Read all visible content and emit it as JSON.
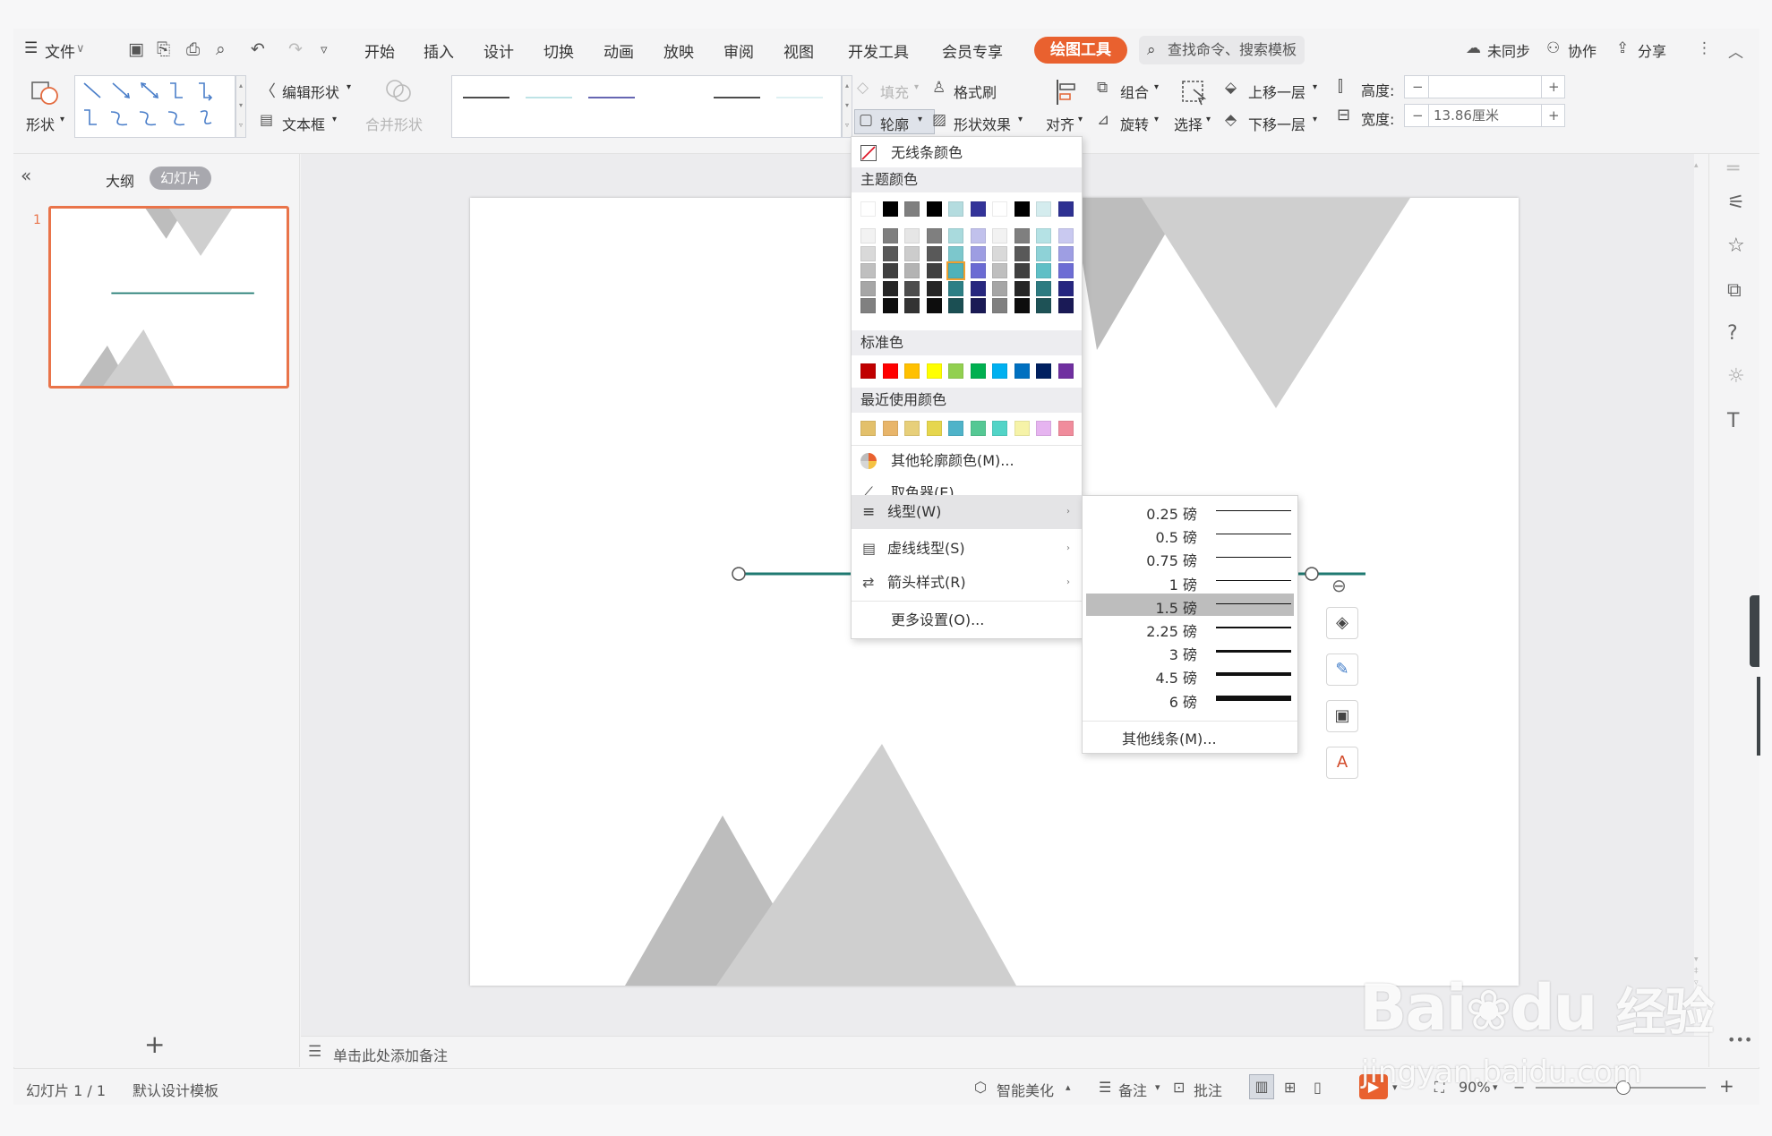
{
  "menubar": {
    "file_label": "文件",
    "tabs": [
      "开始",
      "插入",
      "设计",
      "切换",
      "动画",
      "放映",
      "审阅",
      "视图",
      "开发工具",
      "会员专享"
    ],
    "active_tab": "绘图工具",
    "search_placeholder": "查找命令、搜索模板",
    "sync_label": "未同步",
    "collab_label": "协作",
    "share_label": "分享"
  },
  "ribbon": {
    "shape_label": "形状",
    "edit_shape": "编辑形状",
    "textbox": "文本框",
    "merge_shape": "合并形状",
    "fill": "填充",
    "format_painter": "格式刷",
    "outline": "轮廓",
    "shape_effect": "形状效果",
    "align": "对齐",
    "group": "组合",
    "rotate": "旋转",
    "select": "选择",
    "bring_forward": "上移一层",
    "send_backward": "下移一层",
    "height_label": "高度:",
    "height_value": "",
    "width_label": "宽度:",
    "width_value": "13.86厘米"
  },
  "left_panel": {
    "outline_tab": "大纲",
    "slides_tab": "幻灯片",
    "slide_number": "1",
    "add_slide": "+"
  },
  "notes_placeholder": "单击此处添加备注",
  "outline_menu": {
    "no_line_color": "无线条颜色",
    "theme_colors_title": "主题颜色",
    "standard_colors_title": "标准色",
    "recent_colors_title": "最近使用颜色",
    "more_colors": "其他轮廓颜色(M)...",
    "eyedropper": "取色器(E)",
    "line_type": "线型(W)",
    "dash_type": "虚线线型(S)",
    "arrow_style": "箭头样式(R)",
    "more_settings": "更多设置(O)...",
    "theme_top_row": [
      "#ffffff",
      "#000000",
      "#7f7f7f",
      "#000000",
      "#b4dcdf",
      "#333399",
      "#ffffff",
      "#000000",
      "#d4ecee",
      "#2e3192"
    ],
    "theme_columns": [
      [
        "#f2f2f2",
        "#d9d9d9",
        "#bfbfbf",
        "#a6a6a6",
        "#808080"
      ],
      [
        "#7f7f7f",
        "#595959",
        "#404040",
        "#262626",
        "#0d0d0d"
      ],
      [
        "#e6e6e6",
        "#cccccc",
        "#b3b3b3",
        "#4d4d4d",
        "#333333"
      ],
      [
        "#7f7f7f",
        "#595959",
        "#404040",
        "#262626",
        "#0d0d0d"
      ],
      [
        "#a9dadd",
        "#7cc7cc",
        "#4fb2b9",
        "#2c7f85",
        "#1b4f53"
      ],
      [
        "#c1c1ec",
        "#9d9de2",
        "#6b6bd3",
        "#27277f",
        "#1a1a55"
      ],
      [
        "#f2f2f2",
        "#d9d9d9",
        "#bfbfbf",
        "#a6a6a6",
        "#808080"
      ],
      [
        "#7f7f7f",
        "#595959",
        "#404040",
        "#262626",
        "#0d0d0d"
      ],
      [
        "#b5e2e5",
        "#8ed2d7",
        "#5fbfc6",
        "#2d7b81",
        "#1e5256"
      ],
      [
        "#c9c9f0",
        "#9e9ee3",
        "#6d6dd4",
        "#262680",
        "#1a1a56"
      ]
    ],
    "standard_colors": [
      "#c00000",
      "#ff0000",
      "#ffc000",
      "#ffff00",
      "#92d050",
      "#00b050",
      "#00b0f0",
      "#0070c0",
      "#002060",
      "#7030a0"
    ],
    "recent_colors": [
      "#e3c06b",
      "#e8b56a",
      "#e7cf7a",
      "#e6d64e",
      "#4fb3c9",
      "#55c894",
      "#52d4c7",
      "#f6f3a8",
      "#e6b4f0",
      "#f08c9c"
    ]
  },
  "line_weight_menu": {
    "options": [
      "0.25 磅",
      "0.5 磅",
      "0.75 磅",
      "1 磅",
      "1.5 磅",
      "2.25 磅",
      "3 磅",
      "4.5 磅",
      "6 磅"
    ],
    "selected": "1.5 磅",
    "more_lines": "其他线条(M)..."
  },
  "statusbar": {
    "slide_counter": "幻灯片 1 / 1",
    "template": "默认设计模板",
    "beautify": "智能美化",
    "notes": "备注",
    "comments": "批注",
    "zoom": "90%"
  },
  "watermark": {
    "brand": "Bai",
    "brand2": "du",
    "brand_cn": "经验",
    "url": "jingyan.baidu.com"
  }
}
